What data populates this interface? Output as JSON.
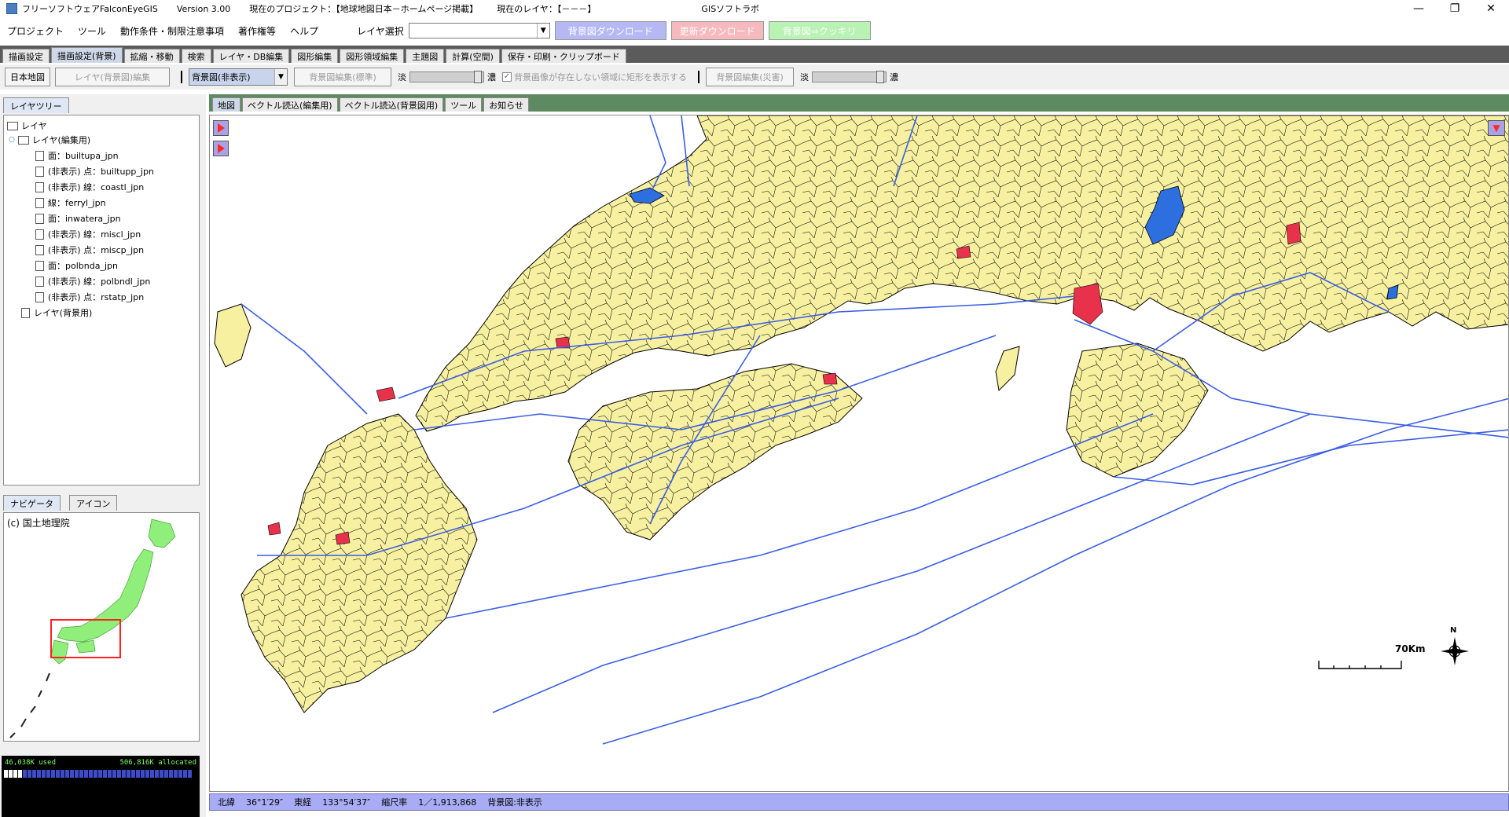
{
  "title": {
    "app": "フリーソフトウェアFalconEyeGIS",
    "version": "Version 3.00",
    "project": "現在のプロジェクト：【地球地図日本－ホームページ掲載】",
    "layer": "現在のレイヤ：【－－－】",
    "company": "GISソフトラボ"
  },
  "menu": {
    "items": [
      "プロジェクト",
      "ツール",
      "動作条件・制限注意事項",
      "著作権等",
      "ヘルプ"
    ],
    "layer_select_label": "レイヤ選択",
    "bg_download": "背景図ダウンロード",
    "update_download": "更新ダウンロード",
    "bg_clear": "背景図⇒クッキリ"
  },
  "tabs": [
    "描画設定",
    "描画設定(背景)",
    "拡縮・移動",
    "検索",
    "レイヤ・DB編集",
    "図形編集",
    "図形領域編集",
    "主題図",
    "計算(空間)",
    "保存・印刷・クリップボード"
  ],
  "toolrow": {
    "japan_map": "日本地図",
    "layer_bg_edit": "レイヤ(背景図)編集",
    "bg_combo": "背景図(非表示)",
    "bg_edit_std": "背景図編集(標準)",
    "light": "淡",
    "dark": "濃",
    "checkbox_label": "背景画像が存在しない領域に矩形を表示する",
    "bg_edit_disaster": "背景図編集(災害)"
  },
  "left": {
    "tree_tab": "レイヤツリー",
    "tree": {
      "root": "レイヤ",
      "edit_group": "レイヤ(編集用)",
      "items": [
        "面：builtupa_jpn",
        "(非表示) 点：builtupp_jpn",
        "(非表示) 線：coastl_jpn",
        "線：ferryl_jpn",
        "面：inwatera_jpn",
        "(非表示) 線：miscl_jpn",
        "(非表示) 点：miscp_jpn",
        "面：polbnda_jpn",
        "(非表示) 線：polbndl_jpn",
        "(非表示) 点：rstatp_jpn"
      ],
      "bg_group": "レイヤ(背景用)"
    },
    "nav_tab": "ナビゲータ",
    "icon_tab": "アイコン",
    "copyright": "(c) 国土地理院",
    "memory_used": "46,038K used",
    "memory_alloc": "506,816K allocated"
  },
  "map": {
    "tabs": [
      "地図",
      "ベクトル読込(編集用)",
      "ベクトル読込(背景図用)",
      "ツール",
      "お知らせ"
    ],
    "scale_label": "70Km",
    "north": "N",
    "colors": {
      "land": "#f6f0a0",
      "water": "#2e6fe0",
      "urban": "#e8324c",
      "ferry": "#3a5ee6"
    }
  },
  "status": {
    "lat_label": "北緯",
    "lat": "36°1′29″",
    "lon_label": "東経",
    "lon": "133°54′37″",
    "scale_label": "縮尺率",
    "scale": "1／1,913,868",
    "bg_label": "背景図:非表示"
  }
}
